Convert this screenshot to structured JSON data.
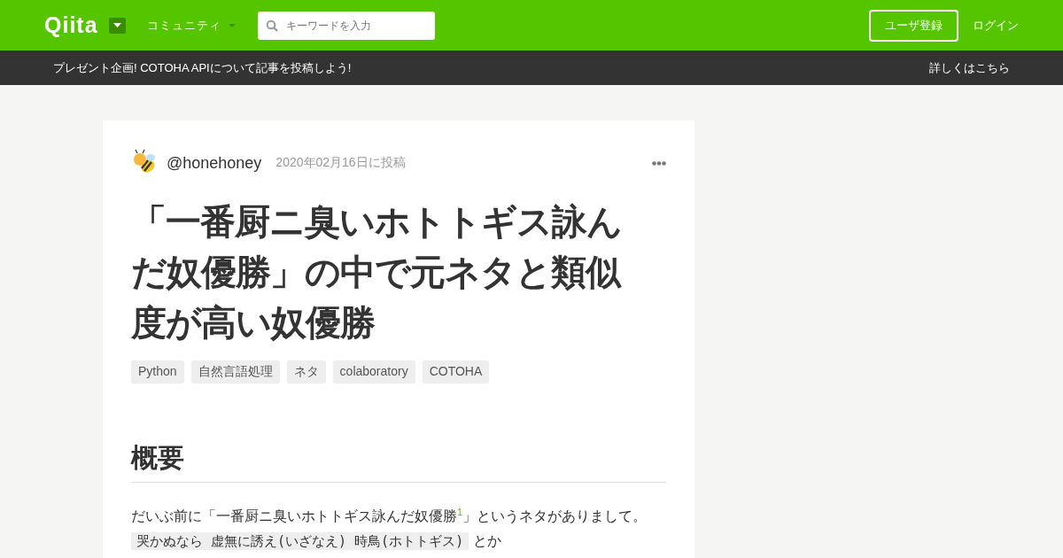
{
  "header": {
    "logo": "Qiita",
    "community_menu": "コミュニティ",
    "search": {
      "placeholder": "キーワードを入力"
    },
    "signup_button": "ユーザ登録",
    "login_link": "ログイン"
  },
  "promo_bar": {
    "message": "プレゼント企画! COTOHA APIについて記事を投稿しよう!",
    "link": "詳しくはこちら"
  },
  "article": {
    "author": "@honehoney",
    "posted": "2020年02月16日に投稿",
    "title": "「一番厨ニ臭いホトトギス詠んだ奴優勝」の中で元ネタと類似度が高い奴優勝",
    "tags": [
      "Python",
      "自然言語処理",
      "ネタ",
      "colaboratory",
      "COTOHA"
    ],
    "heading": "概要",
    "paragraph": "だいぶ前に「一番厨ニ臭いホトトギス詠んだ奴優勝$^{1}$」というネタがありまして。",
    "code_line": {
      "code": "哭かぬなら 虚無に誘え(いざなえ) 時鳥(ホトトギス)",
      "text": "とか"
    }
  }
}
